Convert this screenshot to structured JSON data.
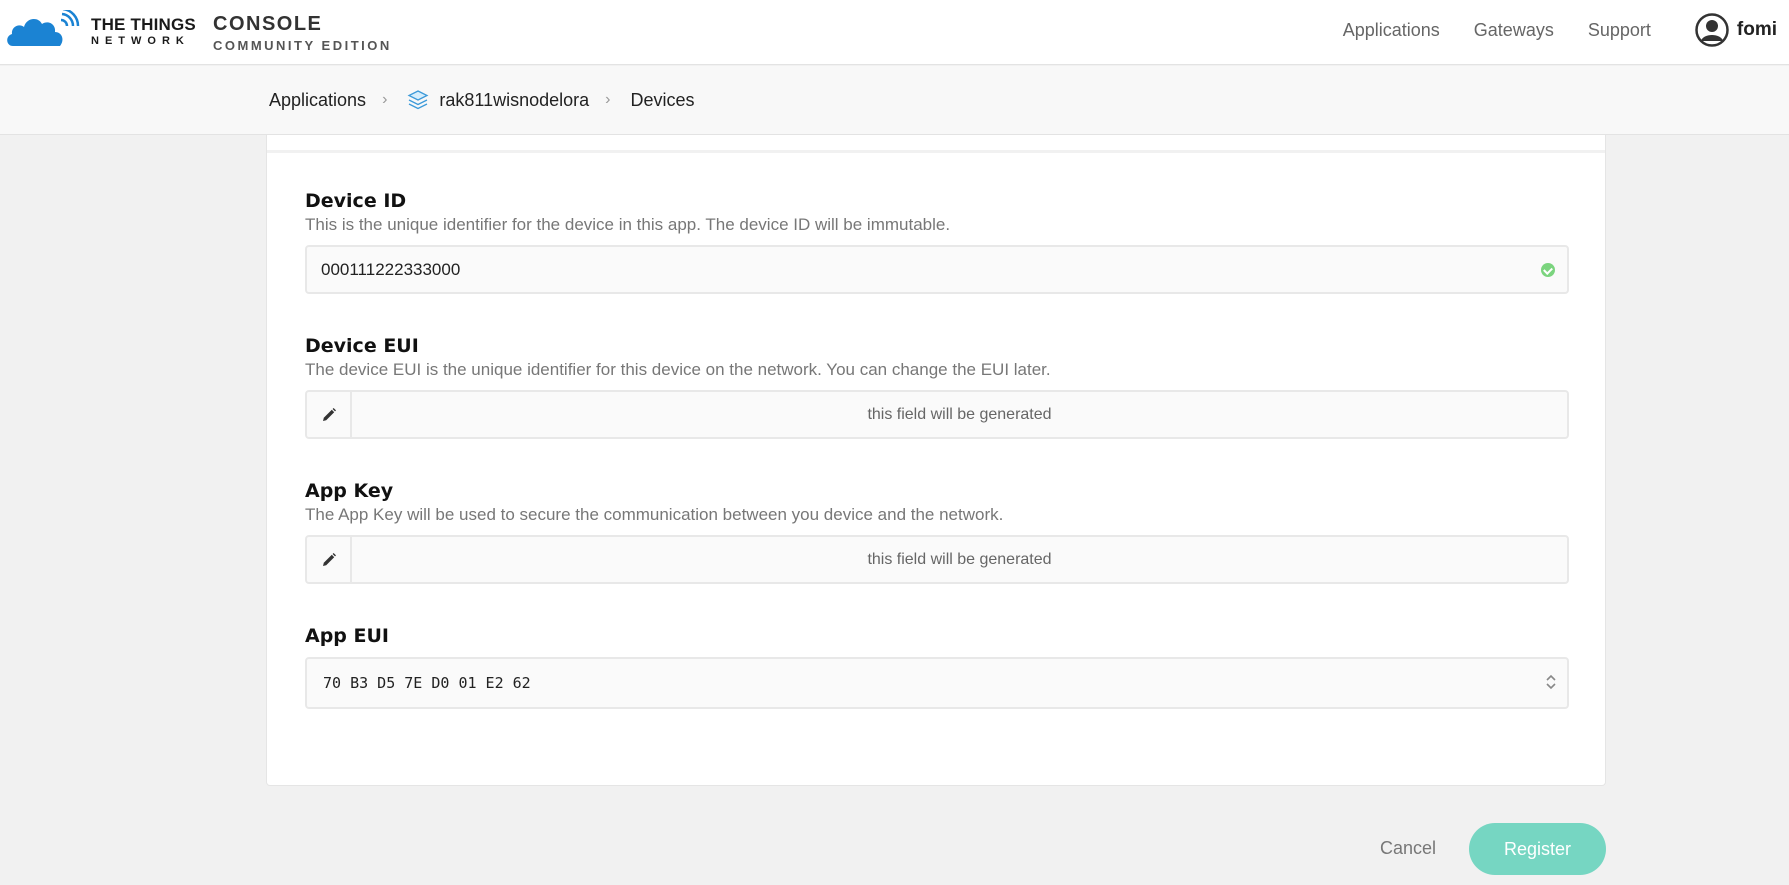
{
  "header": {
    "brand_top": "THE THINGS",
    "brand_bottom": "NETWORK",
    "console_title": "CONSOLE",
    "console_subtitle": "COMMUNITY EDITION",
    "nav": [
      "Applications",
      "Gateways",
      "Support"
    ],
    "user_name": "fomi"
  },
  "breadcrumb": {
    "root": "Applications",
    "app": "rak811wisnodelora",
    "current": "Devices",
    "separator": ">"
  },
  "form": {
    "device_id": {
      "label": "Device ID",
      "description": "This is the unique identifier for the device in this app. The device ID will be immutable.",
      "value": "000111222333000"
    },
    "device_eui": {
      "label": "Device EUI",
      "description": "The device EUI is the unique identifier for this device on the network. You can change the EUI later.",
      "placeholder": "this field will be generated"
    },
    "app_key": {
      "label": "App Key",
      "description": "The App Key will be used to secure the communication between you device and the network.",
      "placeholder": "this field will be generated"
    },
    "app_eui": {
      "label": "App EUI",
      "value": "70 B3 D5 7E D0 01 E2 62"
    }
  },
  "actions": {
    "cancel": "Cancel",
    "register": "Register"
  },
  "colors": {
    "brand_blue": "#1b83d3",
    "valid_green": "#7bd47e",
    "register_teal": "#76d6c2"
  }
}
